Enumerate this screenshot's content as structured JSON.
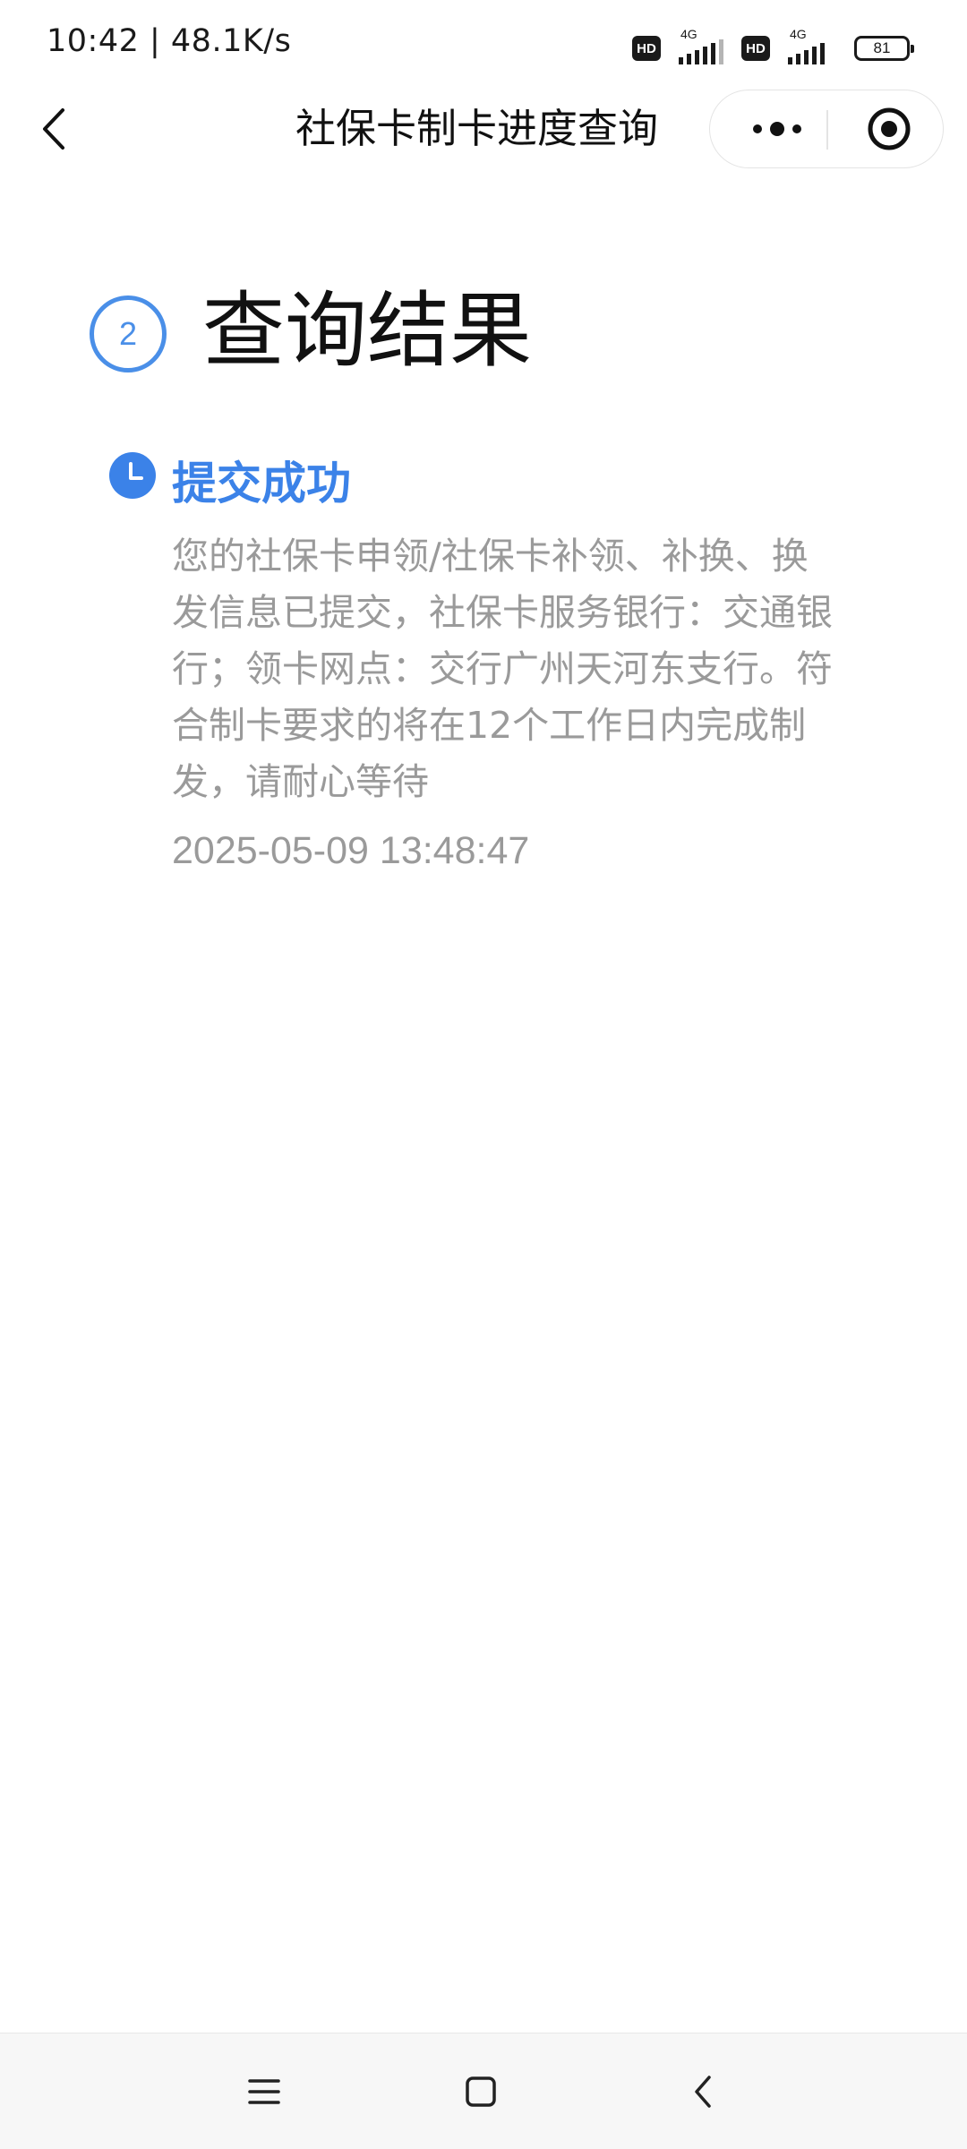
{
  "status_bar": {
    "time_speed": "10:42 | 48.1K/s",
    "hd_label": "HD",
    "network_label": "4G",
    "battery": "81"
  },
  "nav": {
    "title": "社保卡制卡进度查询"
  },
  "result": {
    "step_number": "2",
    "title": "查询结果"
  },
  "status_item": {
    "title": "提交成功",
    "description": "您的社保卡申领/社保卡补领、补换、换发信息已提交，社保卡服务银行：交通银行；领卡网点：交行广州天河东支行。符合制卡要求的将在12个工作日内完成制发，请耐心等待",
    "timestamp": "2025-05-09 13:48:47"
  },
  "colors": {
    "accent": "#3b82e8",
    "muted_text": "#9a9a9a"
  },
  "icons": [
    "back-icon",
    "more-icon",
    "close-target-icon",
    "clock-icon",
    "menu-icon",
    "home-icon",
    "back-nav-icon"
  ]
}
